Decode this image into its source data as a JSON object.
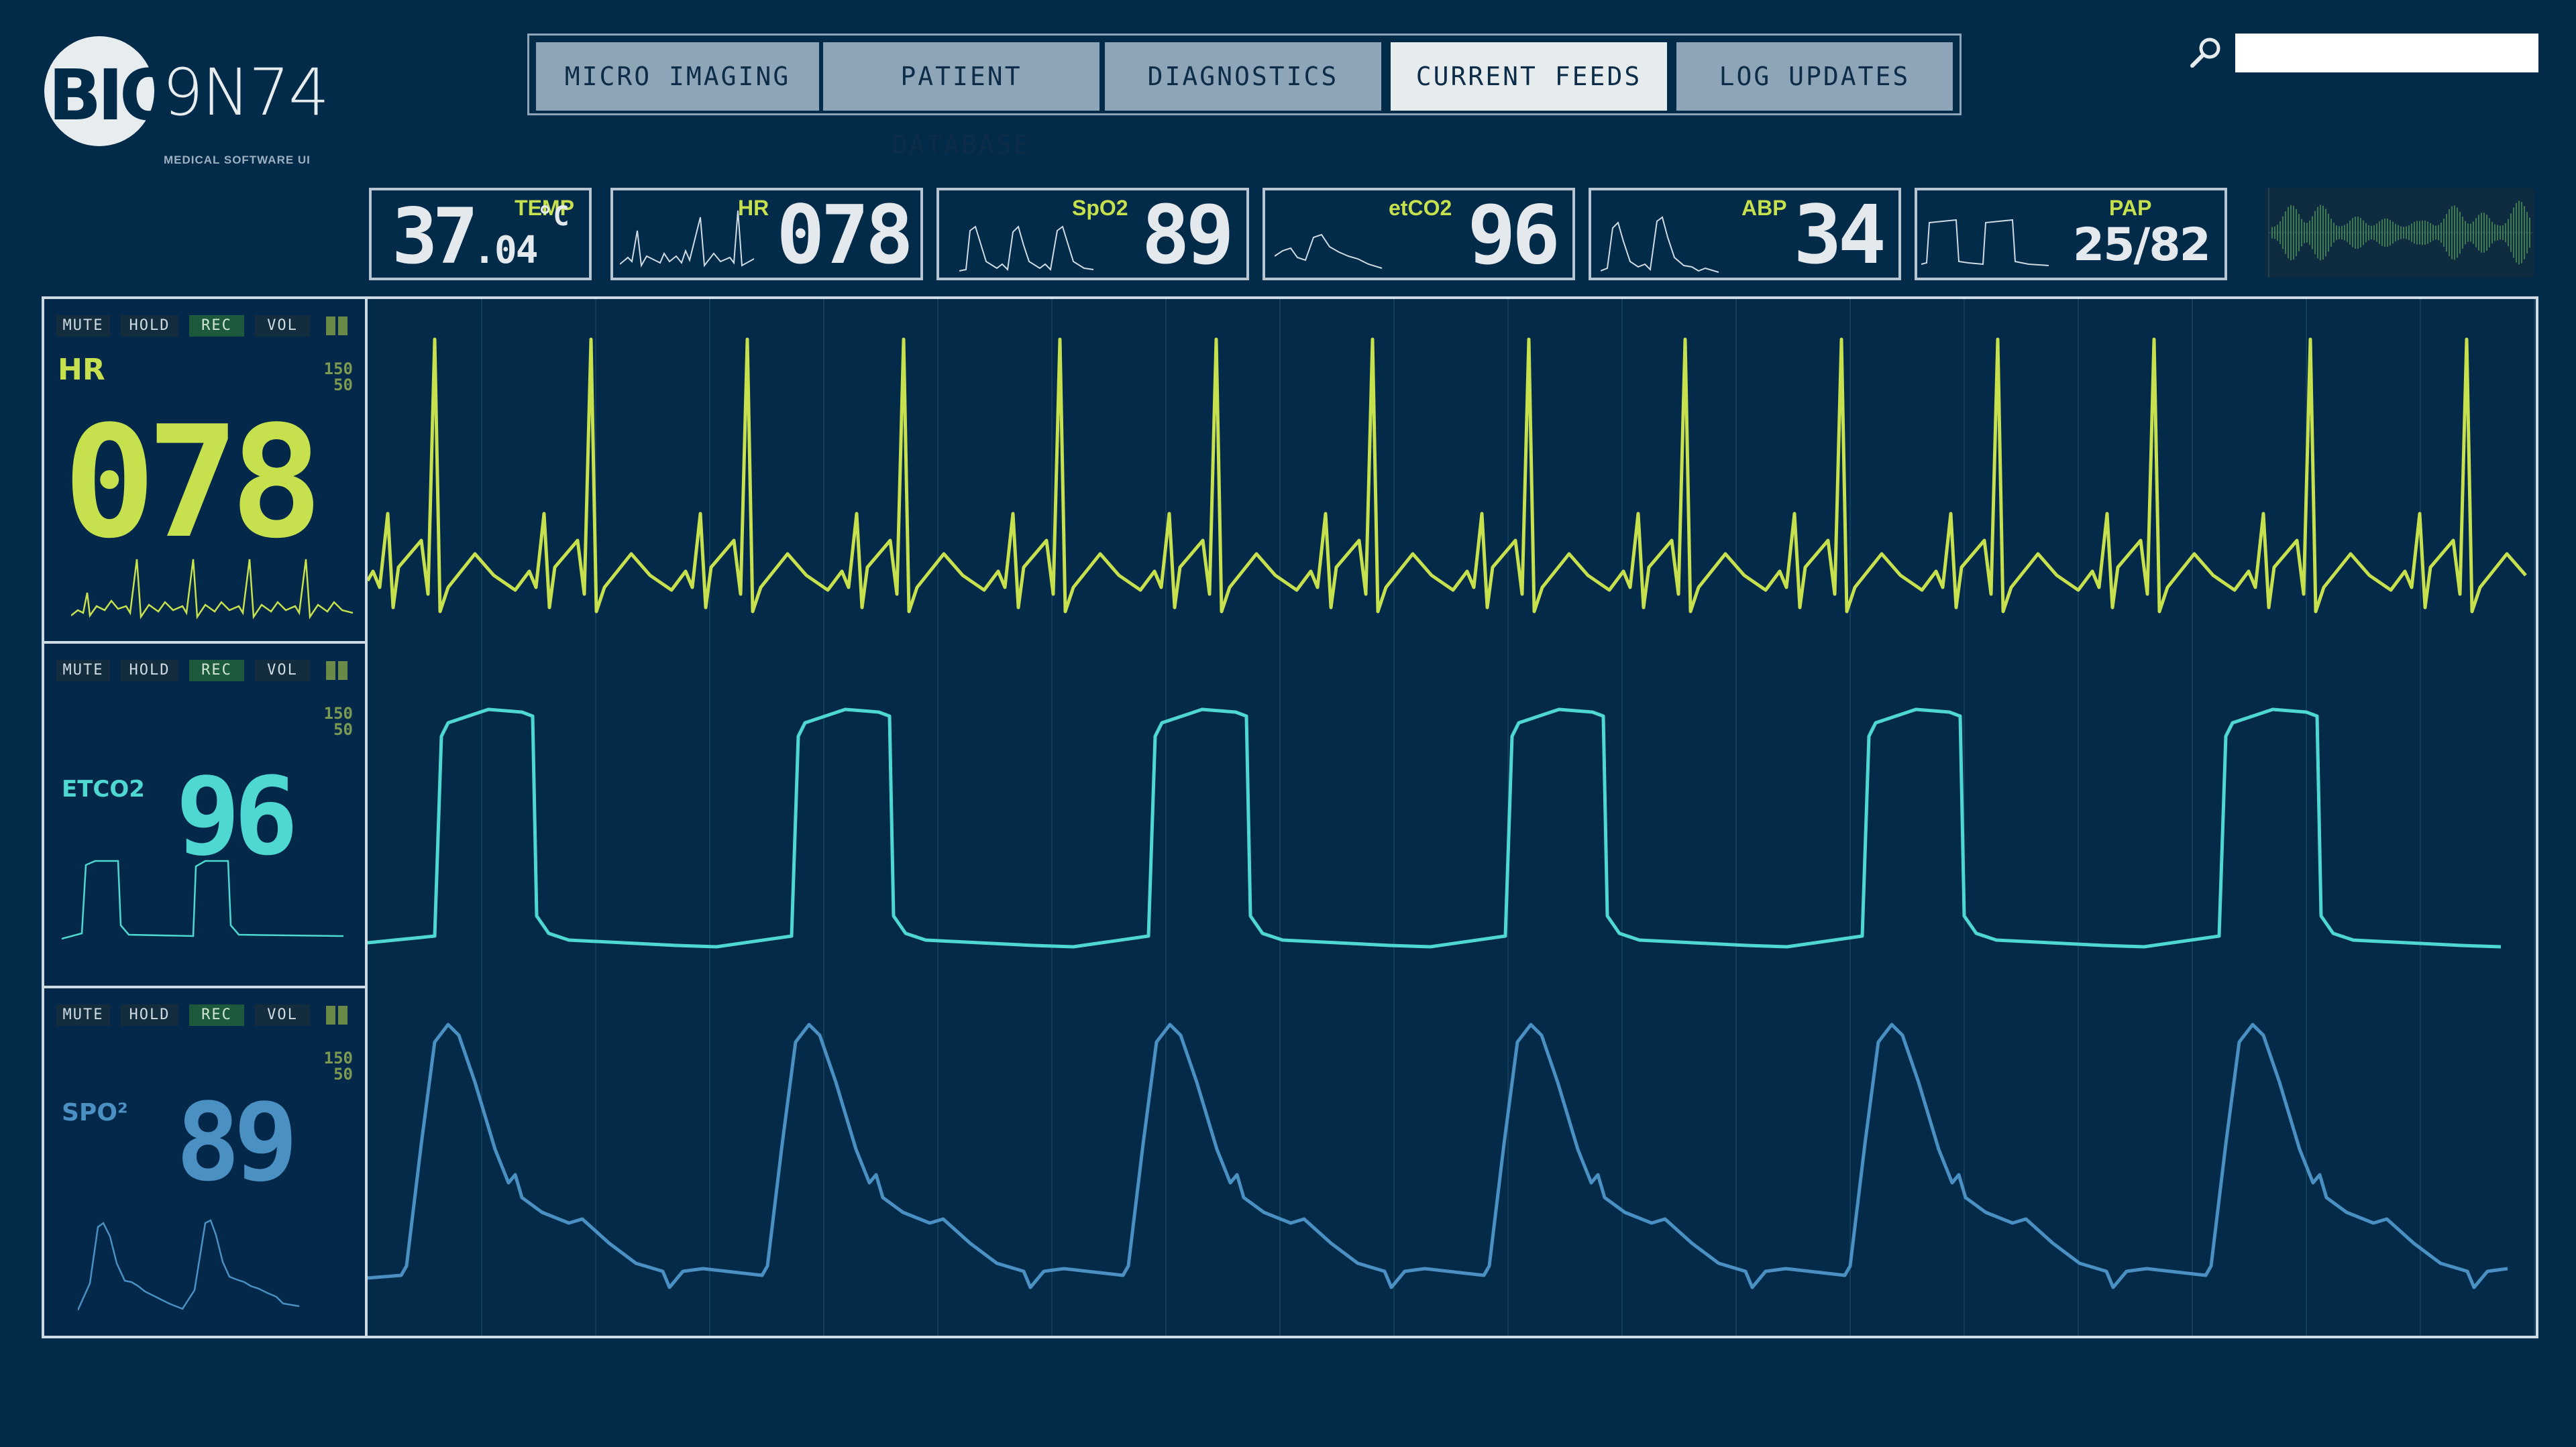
{
  "logo": {
    "mark": "BIO",
    "code": "9N74",
    "subtitle": "MEDICAL SOFTWARE UI"
  },
  "nav": {
    "tabs": [
      {
        "label": "MICRO IMAGING",
        "active": false
      },
      {
        "label": "PATIENT DATABASE",
        "active": false
      },
      {
        "label": "DIAGNOSTICS",
        "active": false
      },
      {
        "label": "CURRENT FEEDS",
        "active": true
      },
      {
        "label": "LOG UPDATES",
        "active": false
      }
    ]
  },
  "search": {
    "value": "",
    "placeholder": ""
  },
  "colors": {
    "background": "#022a49",
    "hr": "#c7e04d",
    "etco2": "#4fd8d2",
    "spo2": "#4a90c2",
    "frame": "#cfdbe3",
    "tab": "#8ea5b8",
    "tab_active": "#e6ebee"
  },
  "vitals": {
    "temp": {
      "label": "TEMP",
      "int": "37",
      "dec": ".04",
      "unit": "°C"
    },
    "hr": {
      "label": "HR",
      "value": "078"
    },
    "spo2": {
      "label": "SpO2",
      "value": "89"
    },
    "etco2": {
      "label": "etCO2",
      "value": "96"
    },
    "abp": {
      "label": "ABP",
      "value": "34"
    },
    "pap": {
      "label": "PAP",
      "value": "25/82"
    }
  },
  "channels": [
    {
      "name": "HR",
      "value": "078",
      "range_hi": "150",
      "range_lo": "50",
      "controls": [
        "MUTE",
        "HOLD",
        "REC",
        "VOL"
      ]
    },
    {
      "name": "ETCO2",
      "value": "96",
      "range_hi": "150",
      "range_lo": "50",
      "controls": [
        "MUTE",
        "HOLD",
        "REC",
        "VOL"
      ]
    },
    {
      "name": "SPO²",
      "value": "89",
      "range_hi": "150",
      "range_lo": "50",
      "controls": [
        "MUTE",
        "HOLD",
        "REC",
        "VOL"
      ]
    }
  ],
  "icons": {
    "search": "search-icon",
    "volume": "volume-bars-icon"
  }
}
